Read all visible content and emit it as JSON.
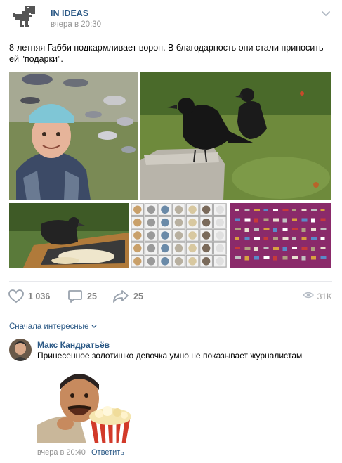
{
  "post": {
    "group_name": "IN IDEAS",
    "time": "вчера в 20:30",
    "text": "8-летняя Габби подкармливает ворон. В благодарность они стали приносить ей \"подарки\"."
  },
  "actions": {
    "likes": "1 036",
    "comments": "25",
    "shares": "25",
    "views": "31K"
  },
  "comments_section": {
    "sort_label": "Сначала интересные"
  },
  "comment": {
    "author": "Макс Кандратьёв",
    "text": "Принесенное золотишко девочка умно не показывает журналистам",
    "time": "вчера в 20:40",
    "reply_label": "Ответить"
  },
  "icons": {
    "logo": "dinosaur-logo-icon",
    "menu": "chevron-down-icon",
    "like": "heart-icon",
    "comment": "comment-bubble-icon",
    "share": "share-arrow-icon",
    "views": "eye-icon",
    "sort": "chevron-down-icon"
  },
  "colors": {
    "link": "#2a5885",
    "muted": "#939393",
    "counter": "#828282",
    "divider": "#e7e8ec"
  }
}
